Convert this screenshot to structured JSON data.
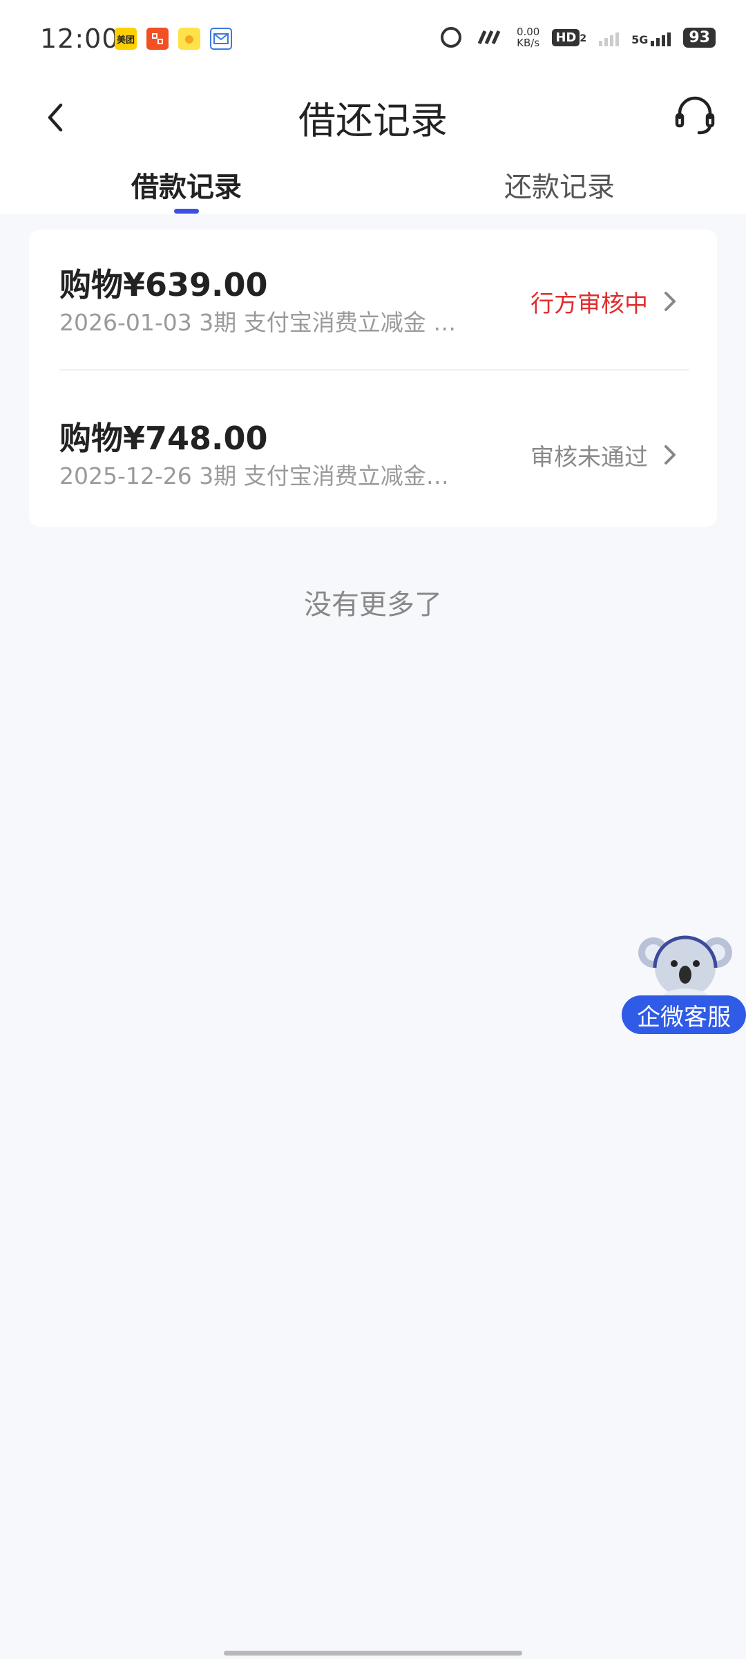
{
  "status_bar": {
    "time": "12:00",
    "app_icons": [
      "meituan-icon",
      "app-red-icon",
      "app-yellow-icon",
      "mail-icon"
    ],
    "app_icon_text": {
      "meituan": "美团"
    },
    "net_speed_value": "0.00",
    "net_speed_unit": "KB/s",
    "hd_label": "HD",
    "hd_sub": "2",
    "network_label": "5G",
    "battery": "93"
  },
  "header": {
    "title": "借还记录",
    "back_icon": "chevron-left-icon",
    "service_icon": "headset-icon"
  },
  "tabs": [
    {
      "label": "借款记录",
      "active": true
    },
    {
      "label": "还款记录",
      "active": false
    }
  ],
  "records": [
    {
      "amount": "购物¥639.00",
      "meta": "2026-01-03 3期  支付宝消费立减金 …",
      "status": "行方审核中",
      "status_color": "#e02d2d"
    },
    {
      "amount": "购物¥748.00",
      "meta": "2025-12-26 3期  支付宝消费立减金…",
      "status": "审核未通过",
      "status_color": "#8a8a8a"
    }
  ],
  "footer_text": "没有更多了",
  "float_service": {
    "label": "企微客服",
    "icon": "koala-mascot-icon"
  },
  "colors": {
    "accent": "#3d4fe0",
    "float_button": "#2f5be6",
    "background": "#f7f8fc"
  }
}
